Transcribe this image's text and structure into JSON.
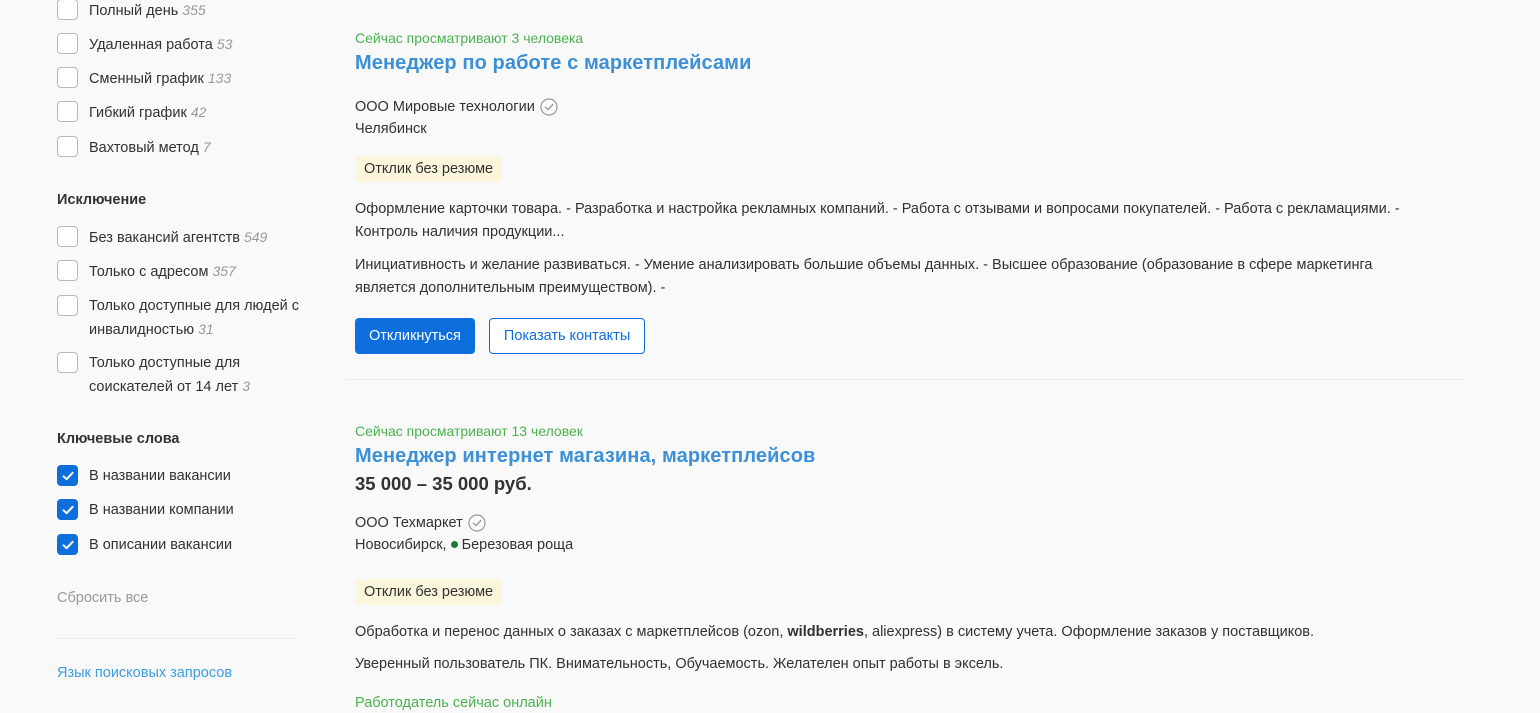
{
  "sidebar": {
    "schedule_items": [
      {
        "label": "Полный день",
        "count": "355",
        "checked": false
      },
      {
        "label": "Удаленная работа",
        "count": "53",
        "checked": false
      },
      {
        "label": "Сменный график",
        "count": "133",
        "checked": false
      },
      {
        "label": "Гибкий график",
        "count": "42",
        "checked": false
      },
      {
        "label": "Вахтовый метод",
        "count": "7",
        "checked": false
      }
    ],
    "exclusion_title": "Исключение",
    "exclusion_items": [
      {
        "label": "Без вакансий агентств",
        "count": "549",
        "checked": false
      },
      {
        "label": "Только с адресом",
        "count": "357",
        "checked": false
      },
      {
        "label": "Только доступные для людей с инвалидностью",
        "count": "31",
        "checked": false
      },
      {
        "label": "Только доступные для соискателей от 14 лет",
        "count": "3",
        "checked": false
      }
    ],
    "keywords_title": "Ключевые слова",
    "keyword_items": [
      {
        "label": "В названии вакансии",
        "checked": true
      },
      {
        "label": "В названии компании",
        "checked": true
      },
      {
        "label": "В описании вакансии",
        "checked": true
      }
    ],
    "reset_label": "Сбросить все",
    "search_lang_label": "Язык поисковых запросов"
  },
  "vacancies": [
    {
      "viewers": "Сейчас просматривают 3 человека",
      "title": "Менеджер по работе с маркетплейсами",
      "company": "ООО Мировые технологии",
      "city": "Челябинск",
      "badge": "Отклик без резюме",
      "responsibilities": "Оформление карточки товара. - Разработка и настройка рекламных компаний. - Работа с отзывами и вопросами покупателей. - Работа с рекламациями. - Контроль наличия продукции...",
      "requirements": "Инициативность и желание развиваться. - Умение анализировать большие объемы данных. - Высшее образование (образование в сфере маркетинга является дополнительным преимуществом). -",
      "respond_label": "Откликнуться",
      "contacts_label": "Показать контакты"
    },
    {
      "viewers": "Сейчас просматривают 13 человек",
      "title": "Менеджер интернет магазина, маркетплейсов",
      "salary": "35 000 – 35 000 руб.",
      "company": "ООО Техмаркет",
      "city": "Новосибирск,",
      "metro": "Березовая роща",
      "badge": "Отклик без резюме",
      "responsibilities_before": "Обработка и перенос данных о заказах с маркетплейсов (ozon, ",
      "responsibilities_bold": "wildberries",
      "responsibilities_after": ", aliexpress) в систему учета. Оформление заказов у поставщиков.",
      "requirements": "Уверенный пользователь ПК. Внимательность, Обучаемость. Желателен опыт работы в эксель.",
      "online_status": "Работодатель сейчас онлайн"
    }
  ],
  "colors": {
    "accent": "#0d6edc",
    "link": "#3c90d8",
    "green": "#4bb24e",
    "badge_bg": "#fcf6dc",
    "metro": "#1a7a3a"
  }
}
